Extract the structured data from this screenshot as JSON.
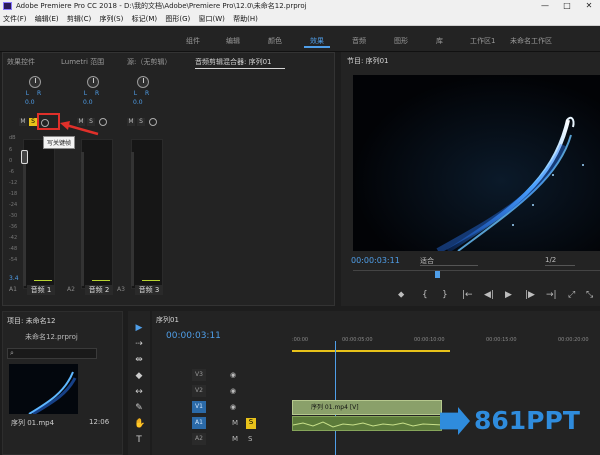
{
  "window": {
    "title": "Adobe Premiere Pro CC 2018 - D:\\我的文档\\Adobe\\Premiere Pro\\12.0\\未命名12.prproj",
    "controls": [
      "—",
      "□",
      "✕"
    ]
  },
  "menu": [
    "文件(F)",
    "编辑(E)",
    "剪辑(C)",
    "序列(S)",
    "标记(M)",
    "图形(G)",
    "窗口(W)",
    "帮助(H)"
  ],
  "workspaces": [
    "组件",
    "编辑",
    "颜色",
    "效果",
    "音频",
    "图形",
    "库",
    "工作区1",
    "未命名工作区"
  ],
  "active_workspace": "效果",
  "left_tabs": [
    "效果控件",
    "Lumetri 范围",
    "源:（无剪辑）",
    "音频剪辑混合器: 序列01"
  ],
  "mixer": {
    "channels": [
      {
        "id": "A1",
        "name": "音频 1",
        "pan": "0.0"
      },
      {
        "id": "A2",
        "name": "音频 2",
        "pan": "0.0"
      },
      {
        "id": "A3",
        "name": "音频 3",
        "pan": "0.0"
      }
    ],
    "lr": "L R",
    "btn_m": "M",
    "btn_s": "S",
    "scale": [
      "dB",
      "6",
      "0",
      "-6",
      "-12",
      "-18",
      "-24",
      "-30",
      "-36",
      "-42",
      "-48",
      "-54"
    ],
    "level_readout": "3.4",
    "tooltip": "写关键帧"
  },
  "program": {
    "title": "节目: 序列01",
    "timecode": "00:00:03:11",
    "fit": "适合",
    "resolution": "1/2",
    "controls": [
      "⬥",
      "{",
      "}",
      "|←",
      "◀|",
      "▶",
      "|▶",
      "→|",
      "⤢",
      "⤡"
    ]
  },
  "project": {
    "title": "项目: 未命名12",
    "file": "未命名12.prproj",
    "clip_name": "序列 01.mp4",
    "clip_dur": "12:06"
  },
  "timeline": {
    "title": "序列01",
    "timecode": "00:00:03:11",
    "ruler": [
      ":00:00",
      "00:00:05:00",
      "00:00:10:00",
      "00:00:15:00",
      "00:00:20:00"
    ],
    "tracks": [
      {
        "id": "V3"
      },
      {
        "id": "V2"
      },
      {
        "id": "V1",
        "clip": "序列 01.mp4 [V]"
      },
      {
        "id": "A1"
      },
      {
        "id": "A2"
      }
    ]
  },
  "watermark": "861PPT",
  "colors": {
    "accent": "#4f9ee8",
    "highlight": "#e0302a",
    "solo": "#e8c21a",
    "logo": "#2f8cdd"
  }
}
